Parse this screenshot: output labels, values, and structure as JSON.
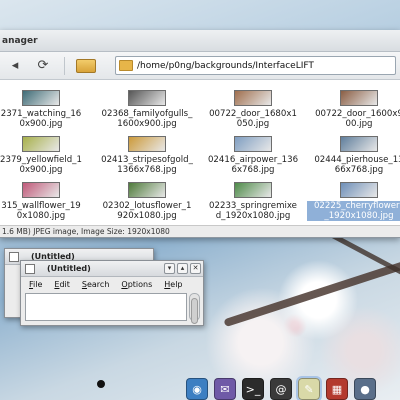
{
  "file_manager": {
    "title": "anager",
    "path": "/home/p0ng/backgrounds/InterfaceLIFT",
    "status": "1.6 MB) JPEG image, Image Size: 1920x1080",
    "files": [
      {
        "name": "2371_watching_16\n0x900.jpg",
        "thumb": "#3f6c77",
        "selected": false
      },
      {
        "name": "02368_familyofgulls_\n1600x900.jpg",
        "thumb": "#565656",
        "selected": false
      },
      {
        "name": "00722_door_1680x1\n050.jpg",
        "thumb": "#a06f4e",
        "selected": false
      },
      {
        "name": "00722_door_1600x9\n00.jpg",
        "thumb": "#8b5e44",
        "selected": false
      },
      {
        "name": "2379_yellowfield_1\n0x900.jpg",
        "thumb": "#a7b04a",
        "selected": false
      },
      {
        "name": "02413_stripesofgold_\n1366x768.jpg",
        "thumb": "#cc9a3a",
        "selected": false
      },
      {
        "name": "02416_airpower_136\n6x768.jpg",
        "thumb": "#7f9ec1",
        "selected": false
      },
      {
        "name": "02444_pierhouse_13\n66x768.jpg",
        "thumb": "#5f7e9c",
        "selected": false
      },
      {
        "name": "315_wallflower_19\n0x1080.jpg",
        "thumb": "#c05a7a",
        "selected": false
      },
      {
        "name": "02302_lotusflower_1\n920x1080.jpg",
        "thumb": "#4f7b3b",
        "selected": false
      },
      {
        "name": "02233_springremixe\nd_1920x1080.jpg",
        "thumb": "#4e8b49",
        "selected": false
      },
      {
        "name": "02225_cherryflowers\n_1920x1080.jpg",
        "thumb": "#6e8fb8",
        "selected": true
      }
    ]
  },
  "editor_back": {
    "title": "(Untitled)",
    "menu": [
      "F"
    ]
  },
  "editor_front": {
    "title": "(Untitled)",
    "menu": [
      {
        "label": "File",
        "key": "F"
      },
      {
        "label": "Edit",
        "key": "E"
      },
      {
        "label": "Search",
        "key": "S"
      },
      {
        "label": "Options",
        "key": "O"
      },
      {
        "label": "Help",
        "key": "H"
      }
    ]
  },
  "dock": [
    {
      "name": "browser-icon",
      "color": "#3d7fc2",
      "glyph": "◉"
    },
    {
      "name": "chat-icon",
      "color": "#6f5aa7",
      "glyph": "✉"
    },
    {
      "name": "terminal-icon",
      "color": "#2b2b2b",
      "glyph": ">_"
    },
    {
      "name": "mail-icon",
      "color": "#3a3a3a",
      "glyph": "@"
    },
    {
      "name": "text-editor-icon",
      "color": "#d9d9a8",
      "glyph": "✎",
      "active": true
    },
    {
      "name": "file-manager-icon",
      "color": "#b33a2e",
      "glyph": "▦"
    },
    {
      "name": "extra-icon",
      "color": "#5a6f8a",
      "glyph": "●"
    }
  ]
}
